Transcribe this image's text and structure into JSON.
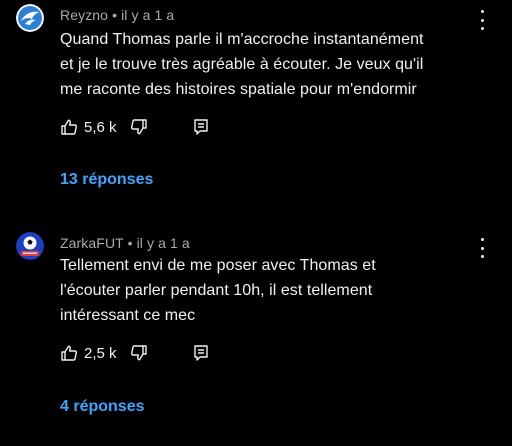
{
  "comments": [
    {
      "author": "Reyzno",
      "time": "il y a 1 a",
      "lines": [
        "Quand Thomas parle il m'accroche instantanément",
        "et je le trouve très agréable à écouter. Je veux qu'il",
        "me raconte des histoires spatiale pour m'endormir"
      ],
      "likes": "5,6 k",
      "replies_label": "13 réponses",
      "avatar_icon": "blue-bird-logo-icon"
    },
    {
      "author": "ZarkaFUT",
      "time": "il y a 1 a",
      "lines": [
        "Tellement envi de me poser avec Thomas et",
        "l'écouter parler pendant 10h, il est tellement",
        "intéressant ce mec"
      ],
      "likes": "2,5 k",
      "replies_label": "4 réponses",
      "avatar_icon": "soccer-ball-logo-icon"
    }
  ],
  "separator": "•",
  "colors": {
    "background": "#000000",
    "text": "#f1f1f1",
    "meta": "#aaaaaa",
    "link": "#3ea6ff"
  }
}
